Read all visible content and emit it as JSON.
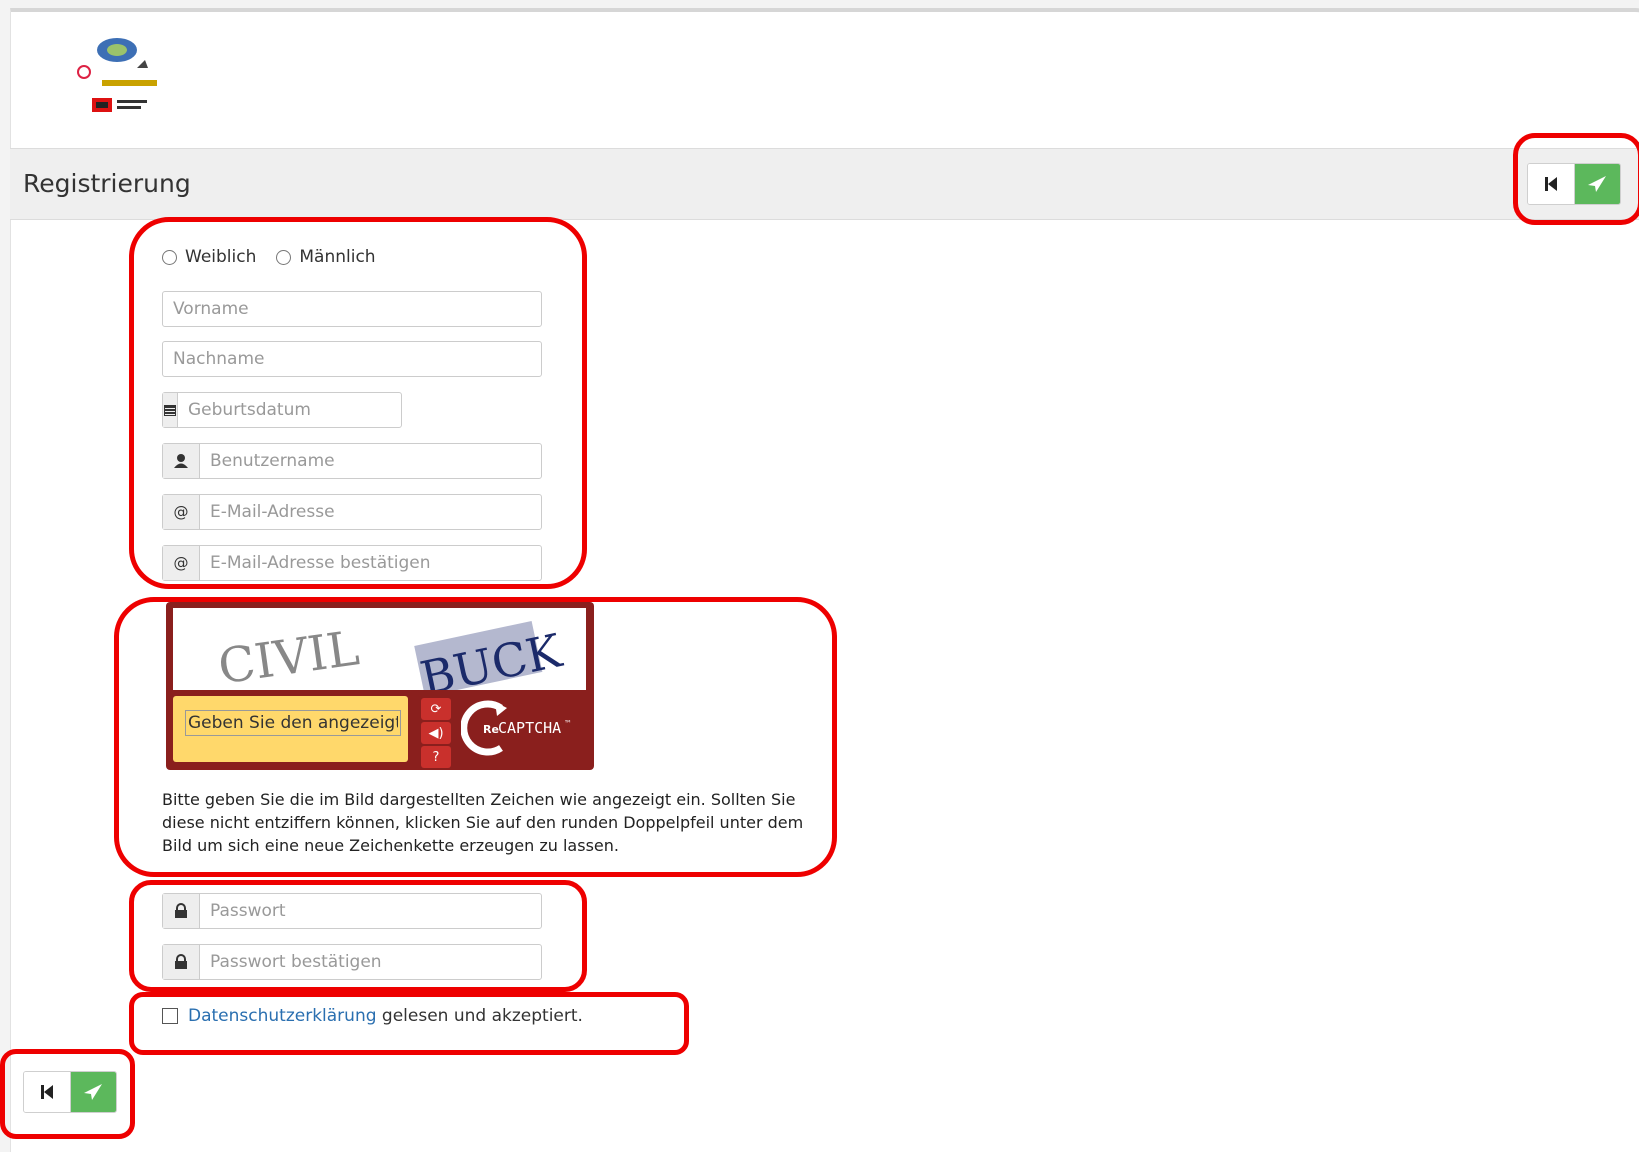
{
  "header": {
    "title": "Registrierung"
  },
  "gender": {
    "options": [
      "Weiblich",
      "Männlich"
    ]
  },
  "fields": {
    "first_name": "Vorname",
    "last_name": "Nachname",
    "birthdate": "Geburtsdatum",
    "username": "Benutzername",
    "email": "E-Mail-Adresse",
    "email_confirm": "E-Mail-Adresse bestätigen",
    "password": "Passwort",
    "password_confirm": "Passwort bestätigen"
  },
  "captcha": {
    "word1": "CIVIL",
    "word2": "BUCK",
    "input_placeholder": "Geben Sie den angezeigten Text ein",
    "logo_re": "Re",
    "logo_text": "CAPTCHA",
    "logo_tm": "™",
    "help": "Bitte geben Sie die im Bild dargestellten Zeichen wie angezeigt ein. Sollten Sie diese nicht entziffern können, klicken Sie auf den runden Doppelpfeil unter dem Bild um sich eine neue Zeichenkette erzeugen zu lassen."
  },
  "privacy": {
    "link": "Datenschutzerklärung",
    "text": " gelesen und akzeptiert."
  },
  "colors": {
    "accent_green": "#5cb85c",
    "highlight_red": "#ee0000",
    "captcha_red": "#8a1f1d",
    "link_blue": "#2a6fb0"
  },
  "icons": [
    "first-icon",
    "send-icon",
    "calendar-icon",
    "user-icon",
    "at-icon",
    "lock-icon",
    "refresh-icon",
    "audio-icon",
    "help-icon"
  ]
}
